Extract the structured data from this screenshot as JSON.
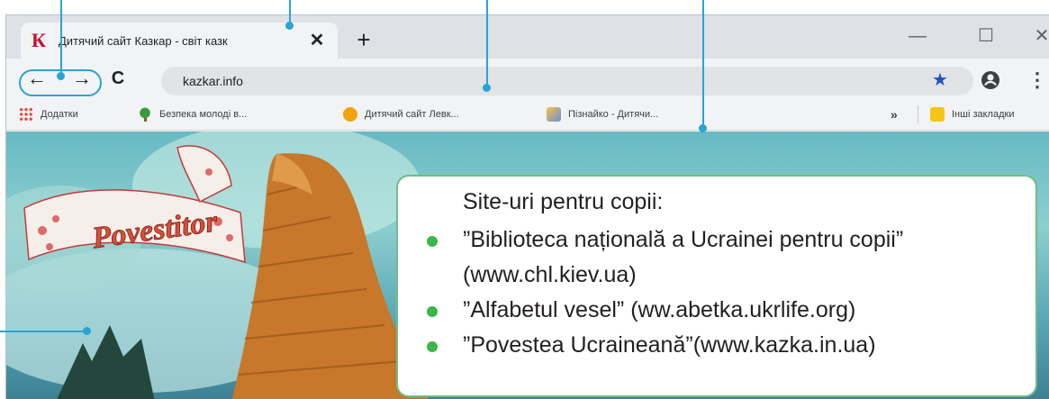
{
  "tab": {
    "title": "Дитячий сайт Казкар - світ казк",
    "favicon": "К",
    "close": "✕",
    "new_tab": "+"
  },
  "window_controls": {
    "minimize": "—",
    "maximize": "☐",
    "close": "✕"
  },
  "toolbar": {
    "back": "←",
    "forward": "→",
    "reload": "C",
    "url": "kazkar.info",
    "star": "★",
    "profile": "account-icon",
    "menu": "⋮"
  },
  "bookmarks": {
    "items": [
      {
        "label": "Додатки",
        "icon": "apps-icon",
        "color": "#e8453c"
      },
      {
        "label": "Безпека молоді в...",
        "icon": "tree-icon",
        "color": "#3c9a3f"
      },
      {
        "label": "Дитячий сайт Левк...",
        "icon": "face-icon",
        "color": "#f2a20e"
      },
      {
        "label": "Пізнайко - Дитячи...",
        "icon": "picture-icon",
        "color": "#6b8fd6"
      }
    ],
    "overflow": "»",
    "other": "Інші закладки"
  },
  "page": {
    "banner_text": "Povestitor"
  },
  "info": {
    "heading": "Site-uri pentru copii:",
    "items": [
      "”Biblioteca națională a Ucrainei pentru copii” (www.chl.kiev.ua)",
      "”Alfabetul vesel” (ww.abetka.ukrlife.org)",
      "”Povestea Ucraineană”(www.kazka.in.ua)"
    ]
  },
  "colors": {
    "callout": "#2aa3d5",
    "box_border": "#6cbf84",
    "bullet": "#3cb54a",
    "favicon": "#c8102e"
  }
}
